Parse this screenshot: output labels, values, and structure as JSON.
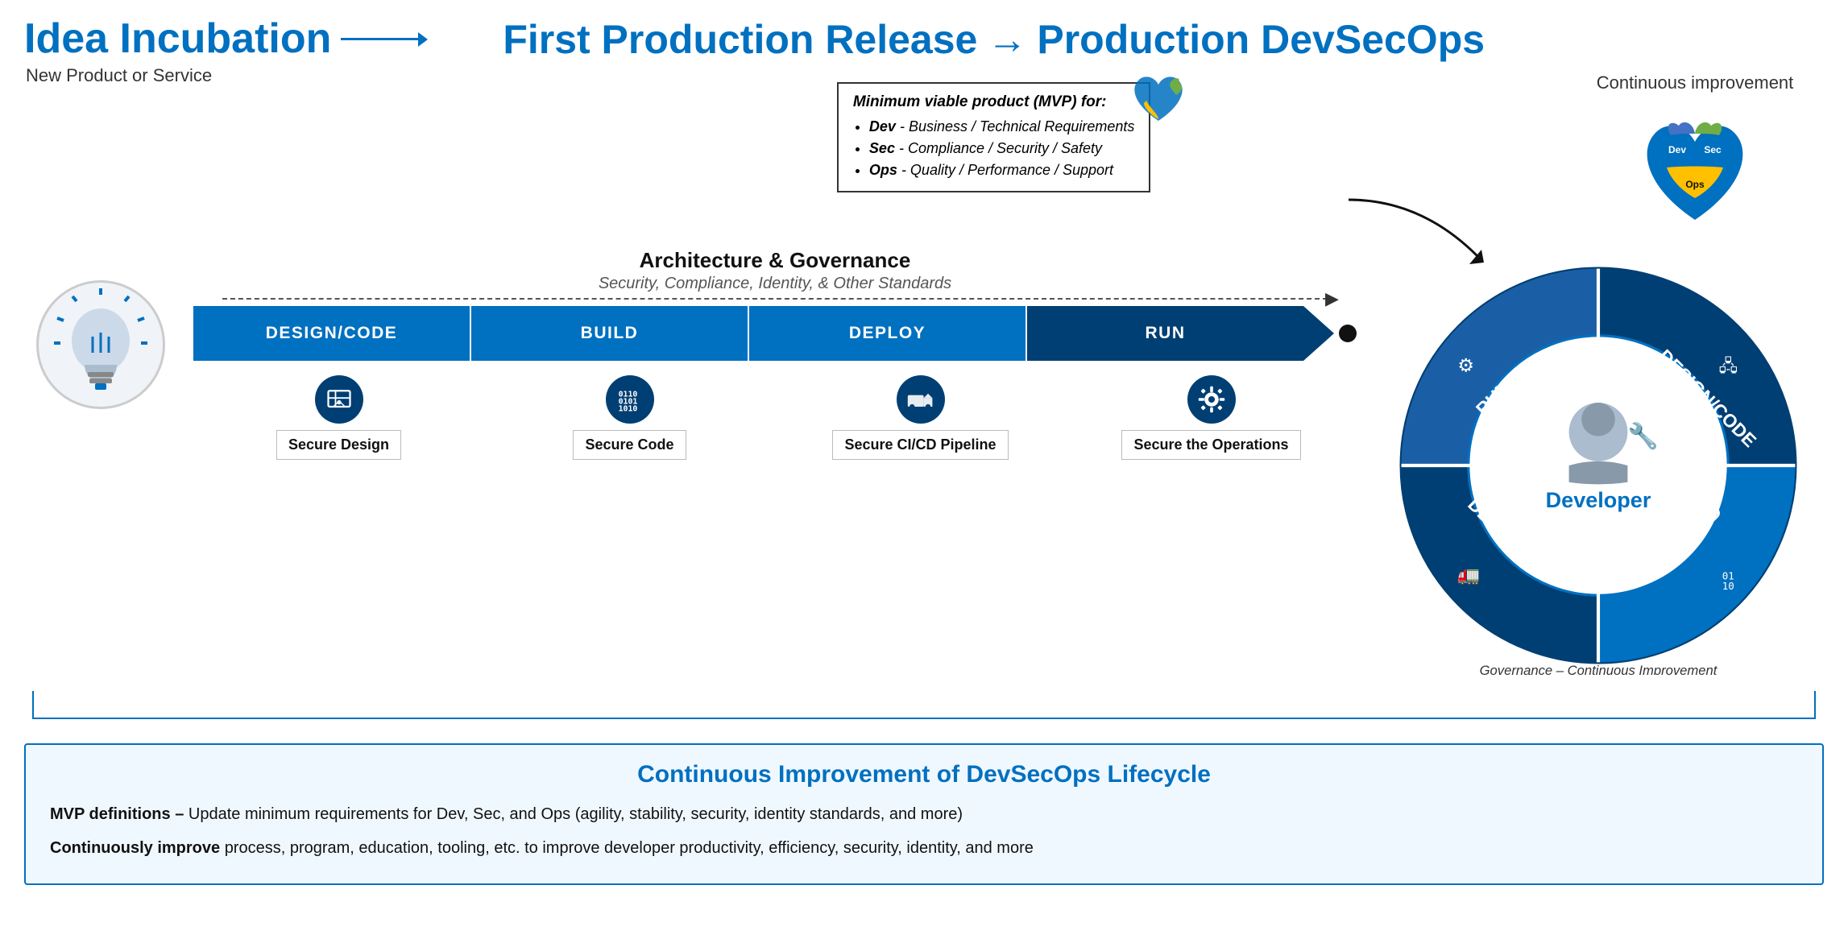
{
  "header": {
    "idea_incubation": "Idea Incubation",
    "idea_subtitle": "New Product or Service",
    "first_production": "First Production Release",
    "arrow_symbol": "→",
    "production_devsecops": "Production DevSecOps",
    "production_subtitle": "Continuous improvement"
  },
  "mvp_box": {
    "title": "Minimum viable product (MVP) for:",
    "items": [
      {
        "bold": "Dev",
        "text": " - Business / Technical Requirements"
      },
      {
        "bold": "Sec",
        "text": " - Compliance / Security / Safety"
      },
      {
        "bold": "Ops",
        "text": " - Quality / Performance / Support"
      }
    ]
  },
  "architecture": {
    "title": "Architecture & Governance",
    "subtitle": "Security, Compliance, Identity, & Other Standards"
  },
  "pipeline": {
    "segments": [
      "DESIGN/CODE",
      "BUILD",
      "DEPLOY",
      "RUN"
    ]
  },
  "stages": [
    {
      "icon": "🖧",
      "label": "Secure Design"
    },
    {
      "icon": "⌨",
      "label": "Secure Code"
    },
    {
      "icon": "🚛",
      "label": "Secure CI/CD Pipeline"
    },
    {
      "icon": "⚙",
      "label": "Secure the Operations"
    }
  ],
  "circular_diagram": {
    "sections": [
      "DESIGN/CODE",
      "BUILD",
      "DEPLOY",
      "RUN"
    ],
    "center_label": "Developer",
    "bottom_label": "Governance – Continuous Improvement"
  },
  "bottom": {
    "title": "Continuous Improvement of DevSecOps Lifecycle",
    "item1_bold": "MVP definitions –",
    "item1_text": " Update minimum requirements for Dev, Sec, and Ops (agility, stability, security, identity standards, and more)",
    "item2_bold": "Continuously improve",
    "item2_text": " process, program, education, tooling, etc. to improve developer productivity, efficiency, security, identity, and more"
  },
  "colors": {
    "blue": "#0070c0",
    "dark_blue": "#003f73",
    "light_bg": "#e8f4fd",
    "border_blue": "#0070c0"
  }
}
